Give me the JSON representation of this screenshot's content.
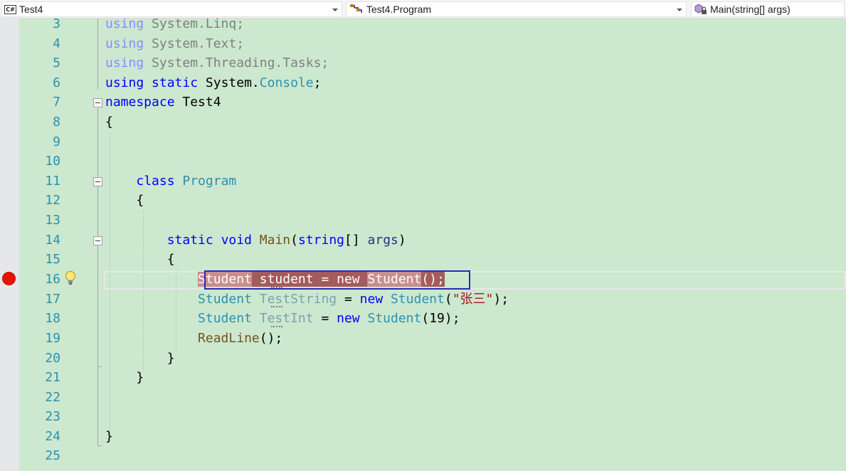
{
  "navbar": {
    "project": "Test4",
    "project_icon": "C#",
    "type": "Test4.Program",
    "member": "Main(string[] args)"
  },
  "editor": {
    "line_numbers": [
      "3",
      "4",
      "5",
      "6",
      "7",
      "8",
      "9",
      "10",
      "11",
      "12",
      "13",
      "14",
      "15",
      "16",
      "17",
      "18",
      "19",
      "20",
      "21",
      "22",
      "23",
      "24",
      "25"
    ],
    "lines": {
      "l3": {
        "kw": "using",
        "rest": " System.Linq;"
      },
      "l4": {
        "kw": "using",
        "rest": " System.Text;"
      },
      "l5": {
        "kw": "using",
        "rest": " System.Threading.Tasks;"
      },
      "l6": {
        "kw1": "using",
        "kw2": "static",
        "ns": " System.",
        "type": "Console",
        "end": ";"
      },
      "l7": {
        "kw": "namespace",
        "name": " Test4"
      },
      "l8": {
        "text": "{"
      },
      "l11": {
        "kw": "class",
        "type": "Program"
      },
      "l12": {
        "text": "{"
      },
      "l14": {
        "kw1": "static",
        "kw2": "void",
        "method": "Main",
        "open": "(",
        "kw3": "string",
        "arr": "[] ",
        "param": "args",
        "close": ")"
      },
      "l15": {
        "text": "{"
      },
      "l16": {
        "type1": "Student",
        "var": " student",
        "eq": " = ",
        "kw": "new",
        "sp": " ",
        "type2": "Student",
        "end": "();"
      },
      "l17": {
        "type1": "Student",
        "var": "TestString",
        "eq": " = ",
        "kw": "new",
        "type2": "Student",
        "open": "(",
        "str": "\"张三\"",
        "end": ");"
      },
      "l18": {
        "type1": "Student",
        "var": "TestInt",
        "eq": " = ",
        "kw": "new",
        "type2": "Student",
        "open": "(",
        "num": "19",
        "end": ");"
      },
      "l19": {
        "method": "ReadLine",
        "end": "();"
      },
      "l20": {
        "text": "}"
      },
      "l21": {
        "text": "}"
      },
      "l24": {
        "text": "}"
      }
    }
  },
  "colors": {
    "background": "#cce8cf",
    "keyword": "#0000ff",
    "type": "#2b91af",
    "method": "#74531f",
    "string": "#a31515",
    "breakpoint": "#e51400"
  }
}
